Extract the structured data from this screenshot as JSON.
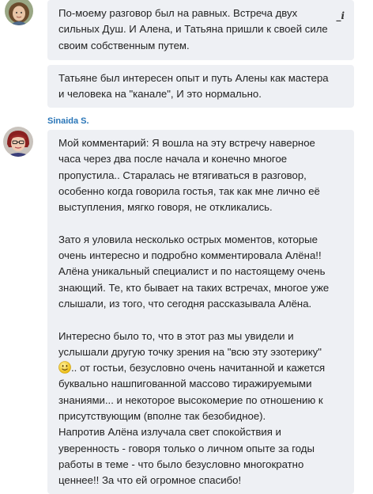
{
  "messages": [
    {
      "lines": [
        "По-моему разговор был на равных. Встреча двух",
        "сильных  Душ. И Алена, и Татьяна пришли к своей силе",
        "своим собственным путем."
      ]
    },
    {
      "lines": [
        "Татьяне был интересен  опыт и путь Алены как мастера",
        "и человека на \"канале\", И это нормально."
      ]
    },
    {
      "sender": "Sinaida S.",
      "lines_a": [
        "Мой комментарий: Я вошла на эту встречу наверное",
        "часа через два после начала и конечно многое",
        "пропустила.. Старалась не втягиваться в разговор,",
        "особенно когда говорила гостья, так как мне лично её",
        "выступления, мягко говоря, не откликались.",
        "",
        "Зато я уловила несколько острых моментов, которые",
        "очень интересно и подробно комментировала Алёна!!",
        "Алёна уникальный специалист и по настоящему очень",
        "знающий. Те, кто бывает на таких встречах, многое уже",
        "слышали, из того, что сегодня рассказывала Алёна.",
        "",
        "Интересно было то, что в этот раз мы увидели и",
        "услышали другую точку зрения на \"всю эту эзотерику\""
      ],
      "smiley_line_rest": ".. от гостьи, безусловно очень начитанной и кажется",
      "lines_b": [
        "буквально нашпигованной массово тиражируемыми",
        "знаниями... и некоторое высокомерие по отношению к",
        "присутствующим (вполне так безобидное).",
        "Напротив Алёна излучала свет спокойствия и",
        "уверенность - говоря только о личном опыте за годы",
        "работы в теме - что было безусловно многократно",
        "ценнее!! За что ей огромное спасибо!"
      ]
    }
  ],
  "toolbar": {
    "italic_label": "_i"
  },
  "icons": {
    "avatar1": "woman-curly-hair-avatar",
    "avatar2": "woman-red-hair-avatar",
    "smiley": "smiley-emoji-icon"
  }
}
